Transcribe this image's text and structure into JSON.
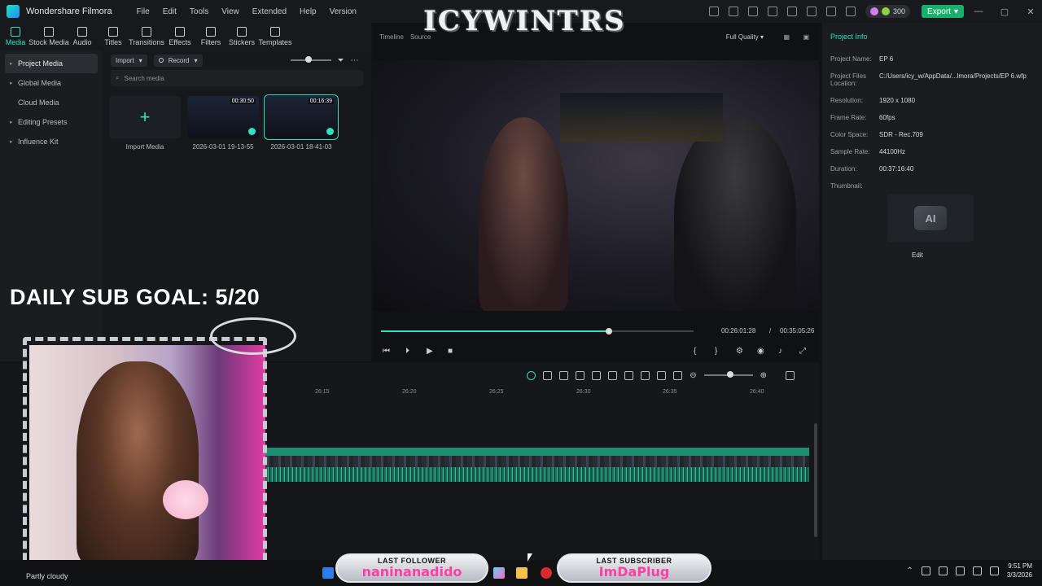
{
  "app": {
    "name": "Wondershare Filmora",
    "menu": [
      "File",
      "Edit",
      "Tools",
      "View",
      "Extended",
      "Help",
      "Version"
    ],
    "credits": "300",
    "export_label": "Export"
  },
  "toolbar": {
    "items": [
      {
        "label": "Media",
        "active": true
      },
      {
        "label": "Stock Media"
      },
      {
        "label": "Audio"
      },
      {
        "label": "Titles"
      },
      {
        "label": "Transitions"
      },
      {
        "label": "Effects"
      },
      {
        "label": "Filters"
      },
      {
        "label": "Stickers"
      },
      {
        "label": "Templates"
      }
    ]
  },
  "media": {
    "nav": [
      {
        "label": "Project Media",
        "active": true
      },
      {
        "label": "Global Media"
      },
      {
        "label": "Cloud Media"
      },
      {
        "label": "Editing Presets"
      },
      {
        "label": "Influence Kit"
      }
    ],
    "import_label": "Import",
    "record_label": "Record",
    "search_placeholder": "Search media",
    "cards": [
      {
        "label": "Import Media",
        "duration": ""
      },
      {
        "label": "2026-03-01 19-13-55",
        "duration": "00:30:50"
      },
      {
        "label": "2026-03-01 18-41-03",
        "duration": "00:16:39"
      }
    ]
  },
  "player": {
    "tab_timeline": "Timeline",
    "tab_source": "Source",
    "quality": "Full Quality",
    "current_time": "00:26:01:28",
    "separator": "/",
    "total_time": "00:35:05:26",
    "progress": 0.73
  },
  "project_info": {
    "title": "Project Info",
    "rows": [
      {
        "key": "Project Name:",
        "value": "EP 6"
      },
      {
        "key": "Project Files Location:",
        "value": "C:/Users/icy_w/AppData/...lmora/Projects/EP 6.wfp"
      },
      {
        "key": "Resolution:",
        "value": "1920 x 1080"
      },
      {
        "key": "Frame Rate:",
        "value": "60fps"
      },
      {
        "key": "Color Space:",
        "value": "SDR - Rec.709"
      },
      {
        "key": "Sample Rate:",
        "value": "44100Hz"
      },
      {
        "key": "Duration:",
        "value": "00:37:16:40"
      },
      {
        "key": "Thumbnail:",
        "value": ""
      }
    ],
    "thumbnail_text": "AI",
    "edit_label": "Edit"
  },
  "timeline": {
    "ticks": [
      "26:15",
      "26:20",
      "26:25",
      "26:30",
      "26:35",
      "26:40"
    ]
  },
  "overlay": {
    "brand": "ICYWINTRS",
    "goal": "DAILY SUB GOAL: 5/20",
    "weather": "Partly cloudy",
    "last_follower_title": "LAST FOLLOWER",
    "last_follower_name": "naninanadido",
    "last_subscriber_title": "LAST SUBSCRIBER",
    "last_subscriber_name": "ImDaPlug"
  },
  "taskbar": {
    "time": "9:51 PM",
    "date": "3/3/2026"
  },
  "colors": {
    "accent": "#2fe0c1",
    "export": "#18b06b",
    "alert_name": "#ff3fa6"
  }
}
